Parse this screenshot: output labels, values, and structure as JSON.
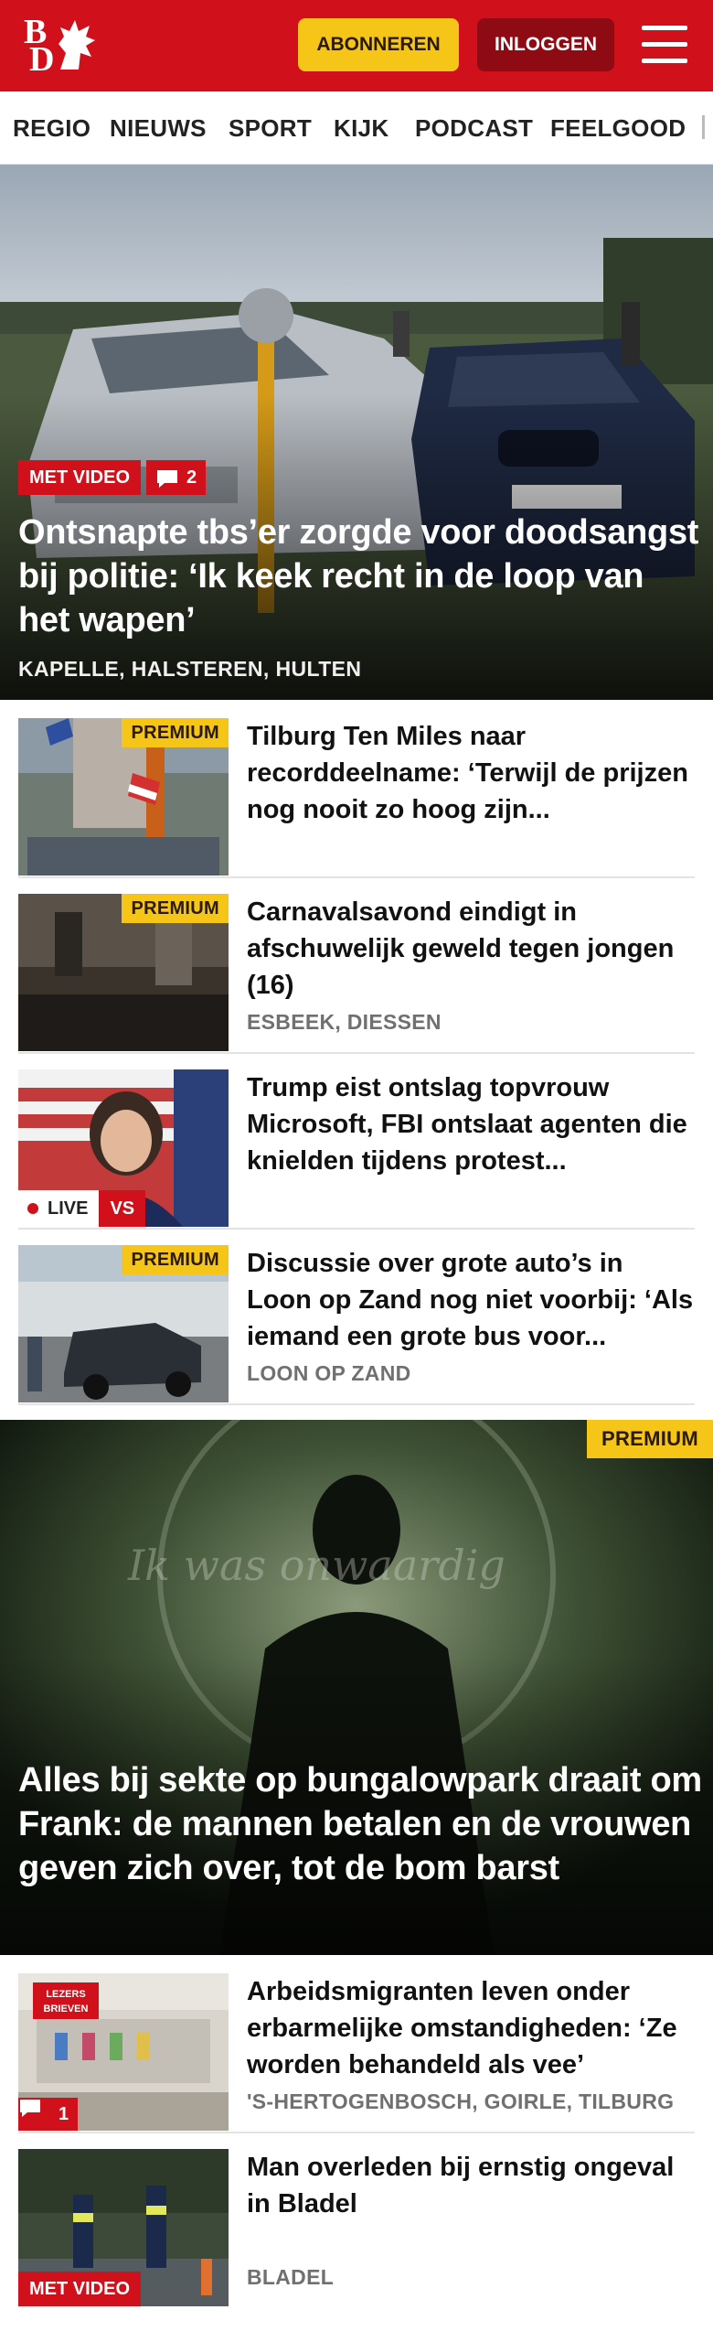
{
  "header": {
    "logo_line1": "B",
    "logo_line2": "D",
    "subscribe_label": "ABONNEREN",
    "login_label": "INLOGGEN",
    "brand_color": "#d0101b"
  },
  "nav": {
    "items": [
      "REGIO",
      "NIEUWS",
      "SPORT",
      "KIJK",
      "PODCAST",
      "FEELGOOD"
    ]
  },
  "hero": {
    "badge": "MET VIDEO",
    "comments": "2",
    "title": "Ontsnapte tbs’er zorgde voor doodsangst bij politie: ‘Ik keek recht in de loop van het wapen’",
    "location": "KAPELLE, HALSTEREN, HULTEN"
  },
  "articles": [
    {
      "badge": "PREMIUM",
      "title": "Tilburg Ten Miles naar recorddeelname: ‘Terwijl de prijzen nog nooit zo hoog zijn...",
      "location": ""
    },
    {
      "badge": "PREMIUM",
      "title": "Carnavalsavond eindigt in afschuwelijk geweld tegen jongen (16)",
      "location": "ESBEEK, DIESSEN"
    },
    {
      "live": "LIVE",
      "vs": "VS",
      "title": "Trump eist ontslag topvrouw Microsoft, FBI ontslaat agenten die knielden tijdens protest...",
      "location": ""
    },
    {
      "badge": "PREMIUM",
      "title": "Discussie over grote auto’s in Loon op Zand nog niet voorbij: ‘Als iemand een grote bus voor...",
      "location": "LOON OP ZAND"
    }
  ],
  "feature": {
    "badge": "PREMIUM",
    "watermark": "Ik was onwaardig",
    "title": "Alles bij sekte op bungalowpark draait om Frank: de mannen betalen en de vrouwen geven zich over, tot de bom barst"
  },
  "articles2": [
    {
      "sign_line1": "LEZERS",
      "sign_line2": "BRIEVEN",
      "comments": "1",
      "title": "Arbeidsmigranten leven onder erbarmelijke omstandigheden: ‘Ze worden behandeld als vee’",
      "location": "'S-HERTOGENBOSCH, GOIRLE, TILBURG"
    },
    {
      "badge": "MET VIDEO",
      "title": "Man overleden bij ernstig ongeval in Bladel",
      "location": "BLADEL"
    }
  ]
}
